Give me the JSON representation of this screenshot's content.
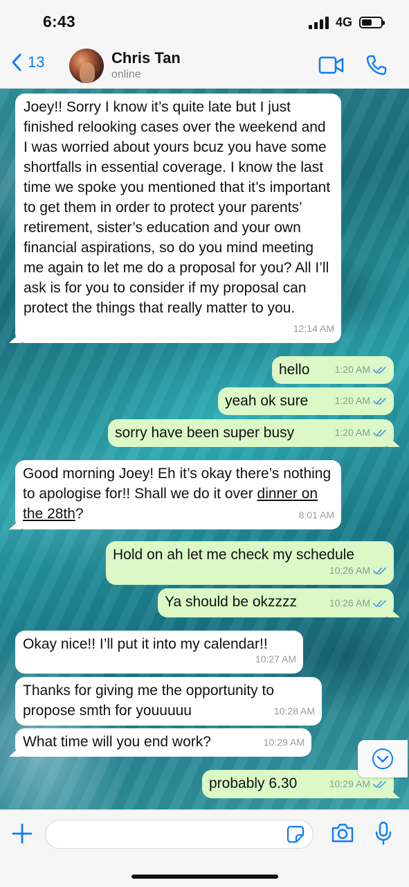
{
  "status_bar": {
    "time": "6:43",
    "network": "4G",
    "battery_level": 0.55
  },
  "header": {
    "back_count": "13",
    "contact_name": "Chris Tan",
    "contact_status": "online"
  },
  "messages": [
    {
      "dir": "in",
      "text": "Joey!! Sorry I know it’s quite late but I just finished relooking cases over the weekend and I was worried about yours bcuz you have some shortfalls in essential coverage. I know the last time we spoke you mentioned that it’s important to get them in order to protect your parents’ retirement, sister’s education and your own financial aspirations, so do you mind meeting me again to let me do a proposal for you? All I’ll ask is for you to consider if my proposal can protect the things that really matter to you.",
      "time": "12:14 AM"
    },
    {
      "dir": "out",
      "text": "hello",
      "time": "1:20 AM",
      "read": true
    },
    {
      "dir": "out",
      "text": "yeah ok sure",
      "time": "1:20 AM",
      "read": true
    },
    {
      "dir": "out",
      "text": "sorry have been super busy",
      "time": "1:20 AM",
      "read": true
    },
    {
      "dir": "in",
      "text_part1": "Good morning Joey! Eh it’s okay there’s nothing to apologise for!! Shall we do it over ",
      "text_link": "dinner on the 28th",
      "text_part2": "?",
      "time": "8:01 AM"
    },
    {
      "dir": "out",
      "text": "Hold on ah let me check my schedule",
      "time": "10:26 AM",
      "read": true
    },
    {
      "dir": "out",
      "text": "Ya should be okzzzz",
      "time": "10:26 AM",
      "read": true
    },
    {
      "dir": "in",
      "text": "Okay nice!! I’ll put it into my calendar!!",
      "time": "10:27 AM"
    },
    {
      "dir": "in",
      "text": "Thanks for giving me the opportunity to propose smth for youuuuu",
      "time": "10:28 AM"
    },
    {
      "dir": "in",
      "text": "What time will you end work?",
      "time": "10:29 AM"
    },
    {
      "dir": "out",
      "text": "probably 6.30",
      "time": "10:29 AM",
      "read": true
    }
  ],
  "input": {
    "placeholder": ""
  },
  "colors": {
    "accent": "#0a7cff",
    "outgoing_bubble": "#dbf8c6",
    "incoming_bubble": "#ffffff",
    "read_tick": "#4fa3e0"
  },
  "icons": [
    "back-chevron-icon",
    "video-call-icon",
    "phone-icon",
    "chevron-down-icon",
    "plus-icon",
    "sticker-icon",
    "camera-icon",
    "microphone-icon"
  ]
}
